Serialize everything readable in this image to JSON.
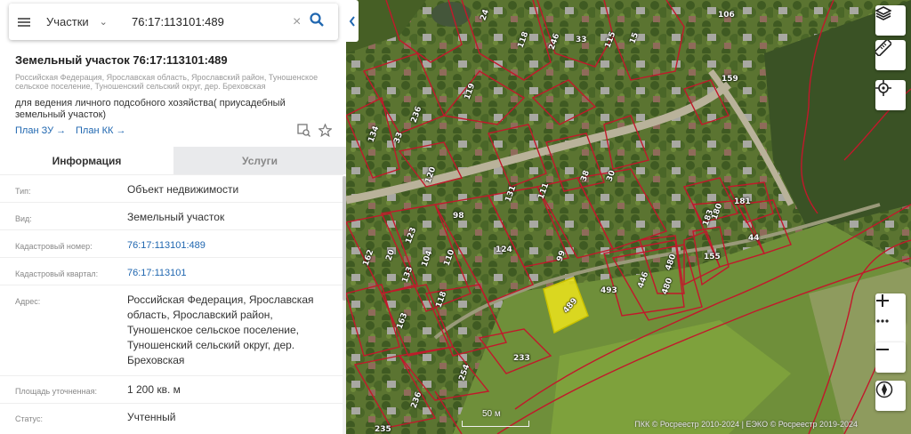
{
  "search": {
    "type_label": "Участки",
    "query": "76:17:113101:489"
  },
  "parcel": {
    "title": "Земельный участок 76:17:113101:489",
    "address_short": "Российская Федерация, Ярославская область, Ярославский район, Туношенское сельское поселение, Туношенский сельский округ, дер. Бреховская",
    "purpose": "для ведения личного подсобного хозяйства( приусадебный земельный участок)",
    "plan_zu": "План ЗУ",
    "plan_kk": "План КК"
  },
  "tabs": {
    "info": "Информация",
    "services": "Услуги"
  },
  "info_rows": [
    {
      "label": "Тип:",
      "value": "Объект недвижимости"
    },
    {
      "label": "Вид:",
      "value": "Земельный участок"
    },
    {
      "label": "Кадастровый номер:",
      "value": "76:17:113101:489"
    },
    {
      "label": "Кадастровый квартал:",
      "value": "76:17:113101"
    },
    {
      "label": "Адрес:",
      "value": "Российская Федерация, Ярославская область, Ярославский район, Туношенское сельское поселение, Туношенский сельский округ, дер. Бреховская"
    },
    {
      "label": "Площадь уточненная:",
      "value": "1 200 кв. м"
    },
    {
      "label": "Статус:",
      "value": "Учтенный"
    }
  ],
  "map": {
    "parcel_labels": [
      "24",
      "118",
      "246",
      "33",
      "115",
      "15",
      "106",
      "159",
      "119",
      "134",
      "236",
      "33",
      "111",
      "120",
      "131",
      "38",
      "30",
      "183",
      "98",
      "123",
      "104",
      "110",
      "124",
      "99",
      "20",
      "180",
      "181",
      "44",
      "155",
      "162",
      "133",
      "446",
      "480",
      "493",
      "480",
      "163",
      "118",
      "489",
      "233",
      "236",
      "254",
      "235"
    ],
    "highlight_label": "489",
    "scale_label": "50 м",
    "attribution": "ПКК © Росреестр 2010-2024 | ЕЭКО © Росреестр 2019-2024",
    "controls": [
      "layers-icon",
      "ruler-icon",
      "locate-icon",
      "zoom-in-icon",
      "more-icon",
      "zoom-out-icon",
      "compass-icon"
    ]
  },
  "colors": {
    "link": "#2067b0",
    "parcel_border": "#c2182b",
    "highlight_fill": "#e9e11c"
  }
}
